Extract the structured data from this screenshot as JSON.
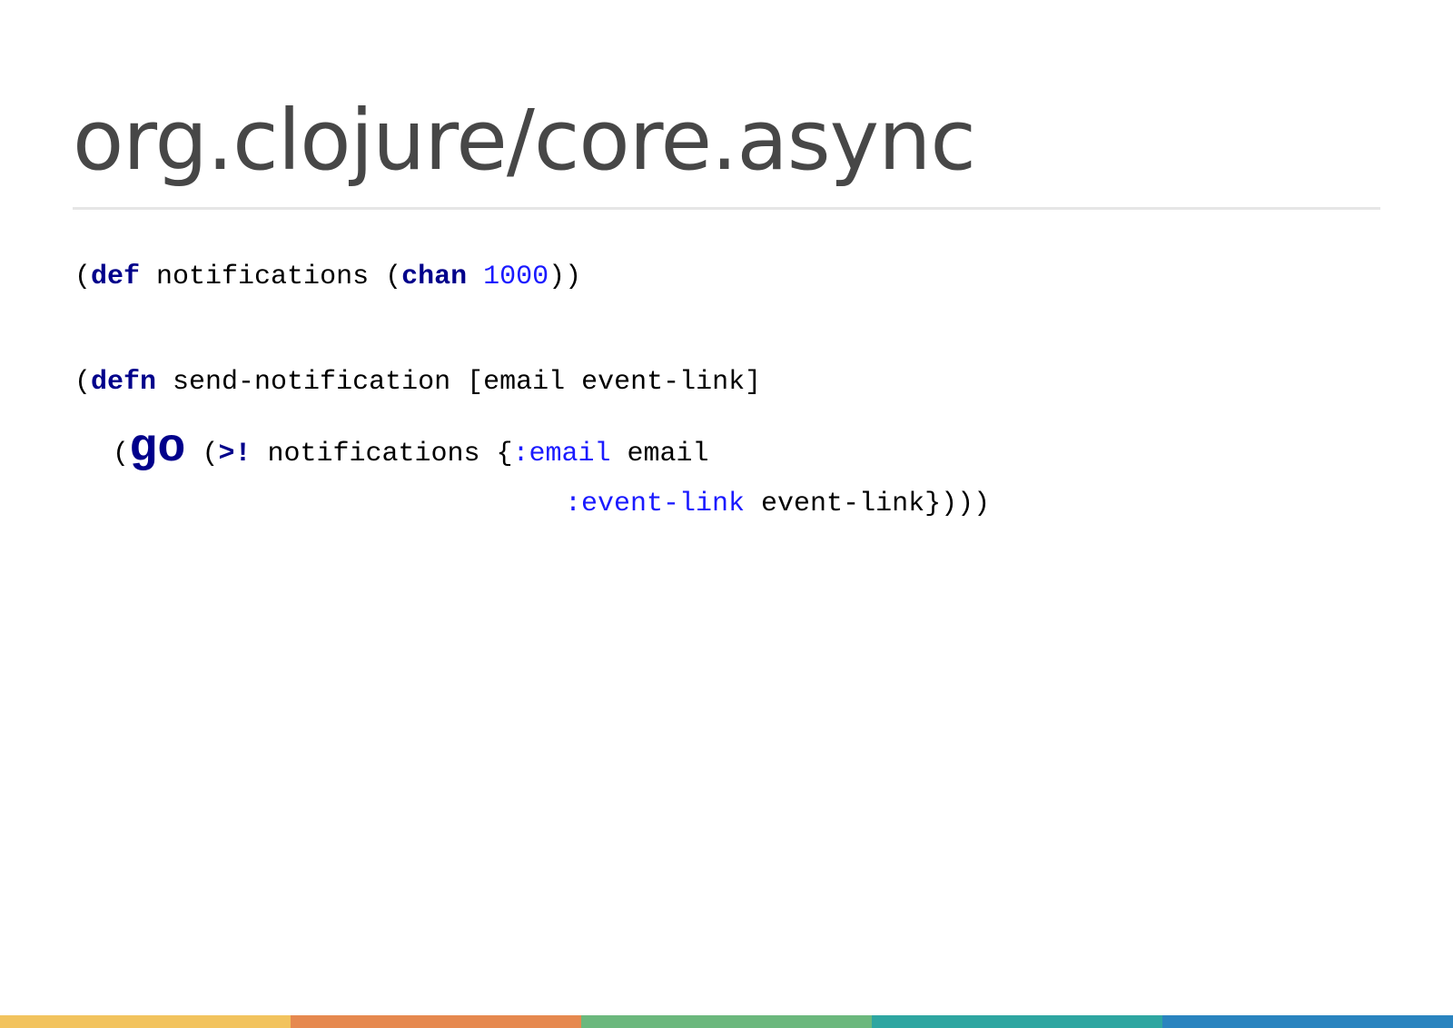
{
  "slide": {
    "title": "org.clojure/core.async"
  },
  "code": {
    "line1": {
      "open1": "(",
      "def_kw": "def",
      "sym": " notifications (",
      "chan_kw": "chan",
      "space": " ",
      "number": "1000",
      "close": "))"
    },
    "line2": {
      "open": "(",
      "defn_kw": "defn",
      "rest": " send-notification [email event-link]"
    },
    "line3": {
      "open": "(",
      "go_kw": "go",
      "mid": " (",
      "put_kw": ">!",
      "sym": " notifications {",
      "email_key": ":email",
      "email_val": " email"
    },
    "line4": {
      "link_key": ":event-link",
      "link_val": " event-link})))"
    }
  },
  "colors": {
    "keyword": "#00008b",
    "literal": "#1a1aff",
    "title": "#474747",
    "footer": [
      "#f2c35e",
      "#e6894f",
      "#6bb87d",
      "#2ea6a1",
      "#2a84bf"
    ]
  }
}
